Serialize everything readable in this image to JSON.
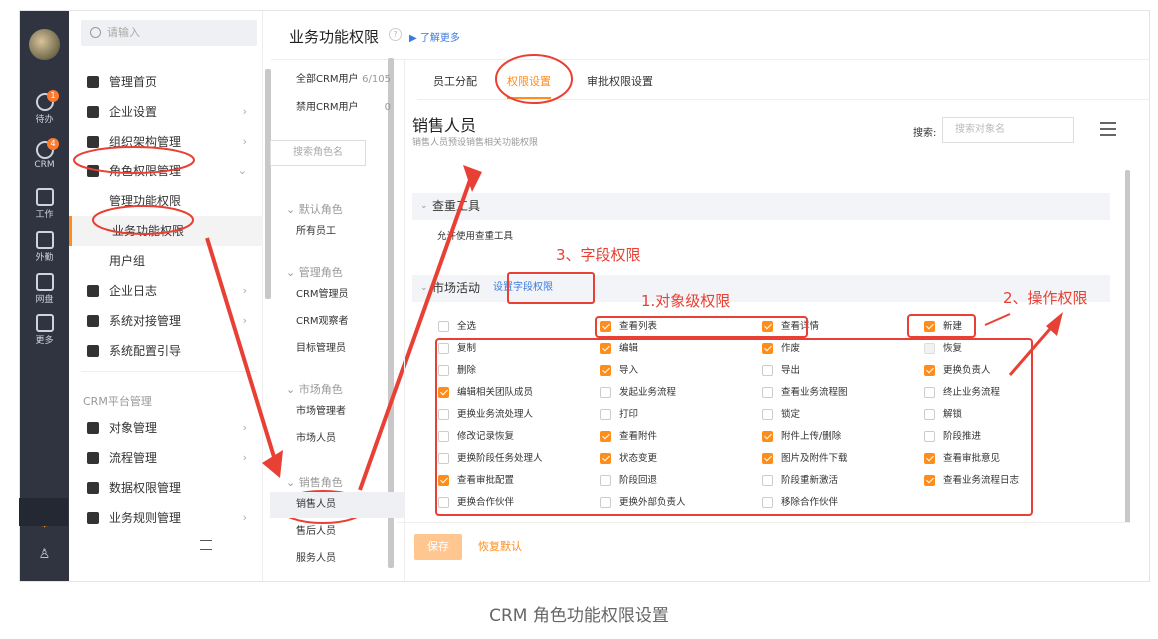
{
  "caption": "CRM 角色功能权限设置",
  "rail": [
    {
      "label": "待办",
      "badge": "1"
    },
    {
      "label": "CRM",
      "badge": "4"
    },
    {
      "label": "工作"
    },
    {
      "label": "外勤"
    },
    {
      "label": "网盘"
    },
    {
      "label": "更多"
    }
  ],
  "nav": {
    "search_placeholder": "请输入",
    "items": [
      {
        "label": "管理首页"
      },
      {
        "label": "企业设置"
      },
      {
        "label": "组织架构管理"
      },
      {
        "label": "角色权限管理"
      },
      {
        "label": "管理功能权限"
      },
      {
        "label": "业务功能权限"
      },
      {
        "label": "用户组"
      },
      {
        "label": "企业日志"
      },
      {
        "label": "系统对接管理"
      },
      {
        "label": "系统配置引导"
      }
    ],
    "section": "CRM平台管理",
    "crm_items": [
      {
        "label": "对象管理"
      },
      {
        "label": "流程管理"
      },
      {
        "label": "数据权限管理"
      },
      {
        "label": "业务规则管理"
      }
    ]
  },
  "header": {
    "title": "业务功能权限",
    "help": "?",
    "more": "了解更多"
  },
  "roles": {
    "all_label": "全部CRM用户",
    "all_count": "6/105",
    "disabled_label": "禁用CRM用户",
    "disabled_count": "0",
    "search_placeholder": "搜索角色名",
    "groups": [
      {
        "name": "默认角色",
        "items": [
          "所有员工"
        ]
      },
      {
        "name": "管理角色",
        "items": [
          "CRM管理员",
          "CRM观察者",
          "目标管理员"
        ]
      },
      {
        "name": "市场角色",
        "items": [
          "市场管理者",
          "市场人员"
        ]
      },
      {
        "name": "销售角色",
        "items": [
          "销售人员",
          "售后人员",
          "服务人员"
        ]
      }
    ]
  },
  "tabs": [
    "员工分配",
    "权限设置",
    "审批权限设置"
  ],
  "role": {
    "title": "销售人员",
    "desc": "销售人员预设销售相关功能权限",
    "search_label": "搜索:",
    "search_placeholder": "搜索对象名"
  },
  "dup_tool": {
    "title": "查重工具",
    "perm": "允许使用查重工具"
  },
  "market": {
    "title": "市场活动",
    "set_field": "设置字段权限"
  },
  "perms": [
    [
      {
        "l": "全选",
        "c": false
      },
      {
        "l": "查看列表",
        "c": true
      },
      {
        "l": "查看详情",
        "c": true
      },
      {
        "l": "新建",
        "c": true
      }
    ],
    [
      {
        "l": "复制",
        "c": false
      },
      {
        "l": "编辑",
        "c": true
      },
      {
        "l": "作废",
        "c": true
      },
      {
        "l": "恢复",
        "c": false,
        "d": true
      }
    ],
    [
      {
        "l": "删除",
        "c": false
      },
      {
        "l": "导入",
        "c": true
      },
      {
        "l": "导出",
        "c": false
      },
      {
        "l": "更换负责人",
        "c": true
      }
    ],
    [
      {
        "l": "编辑相关团队成员",
        "c": true
      },
      {
        "l": "发起业务流程",
        "c": false
      },
      {
        "l": "查看业务流程图",
        "c": false
      },
      {
        "l": "终止业务流程",
        "c": false
      }
    ],
    [
      {
        "l": "更换业务流处理人",
        "c": false
      },
      {
        "l": "打印",
        "c": false
      },
      {
        "l": "锁定",
        "c": false
      },
      {
        "l": "解锁",
        "c": false
      }
    ],
    [
      {
        "l": "修改记录恢复",
        "c": false
      },
      {
        "l": "查看附件",
        "c": true
      },
      {
        "l": "附件上传/删除",
        "c": true
      },
      {
        "l": "阶段推进",
        "c": false
      }
    ],
    [
      {
        "l": "更换阶段任务处理人",
        "c": false
      },
      {
        "l": "状态变更",
        "c": true
      },
      {
        "l": "图片及附件下载",
        "c": true
      },
      {
        "l": "查看审批意见",
        "c": true
      }
    ],
    [
      {
        "l": "查看审批配置",
        "c": true
      },
      {
        "l": "阶段回退",
        "c": false
      },
      {
        "l": "阶段重新激活",
        "c": false
      },
      {
        "l": "查看业务流程日志",
        "c": true
      }
    ],
    [
      {
        "l": "更换合作伙伴",
        "c": false
      },
      {
        "l": "更换外部负责人",
        "c": false
      },
      {
        "l": "移除合作伙伴",
        "c": false
      }
    ]
  ],
  "footer": {
    "save": "保存",
    "reset": "恢复默认"
  },
  "annotations": {
    "object": "1.对象级权限",
    "action": "2、操作权限",
    "field": "3、字段权限"
  },
  "colors": {
    "accent": "#ff8d1a",
    "annotation": "#e84034",
    "link": "#3a7be0",
    "rail": "#2f3440"
  }
}
